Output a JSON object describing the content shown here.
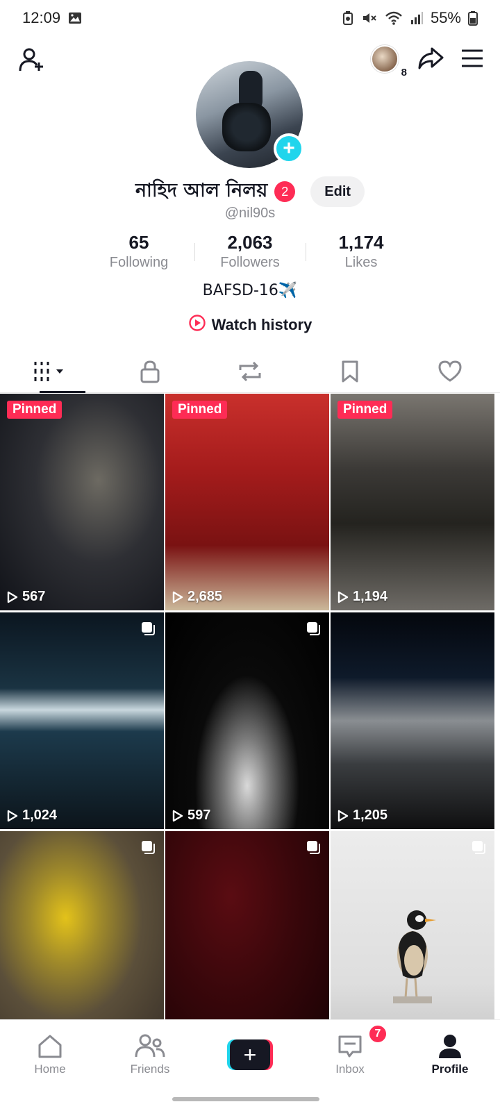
{
  "status_bar": {
    "time": "12:09",
    "battery": "55%"
  },
  "top_bar": {
    "story_count": "8"
  },
  "profile": {
    "display_name": "নাহিদ আল নিলয়",
    "name_badge": "2",
    "edit_label": "Edit",
    "username": "@nil90s",
    "bio": "BAFSD-16✈️",
    "watch_history_label": "Watch history"
  },
  "stats": [
    {
      "value": "65",
      "label": "Following"
    },
    {
      "value": "2,063",
      "label": "Followers"
    },
    {
      "value": "1,174",
      "label": "Likes"
    }
  ],
  "tabs": [
    "videos",
    "private",
    "reposts",
    "favorites",
    "liked"
  ],
  "videos": [
    {
      "pinned": "Pinned",
      "views": "567"
    },
    {
      "pinned": "Pinned",
      "views": "2,685"
    },
    {
      "pinned": "Pinned",
      "views": "1,194"
    },
    {
      "views": "1,024"
    },
    {
      "views": "597"
    },
    {
      "views": "1,205"
    },
    {
      "views": ""
    },
    {
      "views": ""
    },
    {
      "views": ""
    }
  ],
  "bottom_nav": {
    "home": "Home",
    "friends": "Friends",
    "create": "+",
    "inbox": "Inbox",
    "inbox_badge": "7",
    "profile": "Profile"
  },
  "colors": {
    "accent_red": "#fe2c55",
    "accent_cyan": "#20d5ec",
    "text": "#161823",
    "secondary_text": "#8a8b91"
  }
}
